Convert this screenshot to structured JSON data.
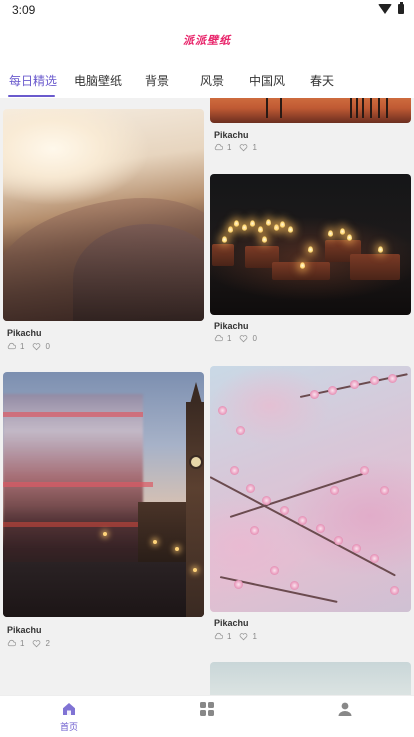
{
  "status_bar": {
    "time": "3:09",
    "icons": [
      "wifi-icon",
      "battery-icon"
    ]
  },
  "header": {
    "logo_text": "派派壁纸",
    "logo_color": "#e8246a"
  },
  "tabs": [
    {
      "label": "每日精选",
      "active": true
    },
    {
      "label": "电脑壁纸",
      "active": false
    },
    {
      "label": "背景",
      "active": false
    },
    {
      "label": "风景",
      "active": false
    },
    {
      "label": "中国风",
      "active": false
    },
    {
      "label": "春天",
      "active": false
    }
  ],
  "accent_color": "#6a5acd",
  "cards": [
    {
      "title": "Pikachu",
      "downloads": "1",
      "likes": "1"
    },
    {
      "title": "Pikachu",
      "downloads": "1",
      "likes": "0"
    },
    {
      "title": "Pikachu",
      "downloads": "1",
      "likes": "0"
    },
    {
      "title": "Pikachu",
      "downloads": "1",
      "likes": "2"
    },
    {
      "title": "Pikachu",
      "downloads": "1",
      "likes": "1"
    }
  ],
  "bottom_nav": [
    {
      "label": "首页",
      "icon": "home-icon",
      "active": true
    },
    {
      "label": "",
      "icon": "category-grid-icon",
      "active": false
    },
    {
      "label": "",
      "icon": "profile-icon",
      "active": false
    }
  ]
}
